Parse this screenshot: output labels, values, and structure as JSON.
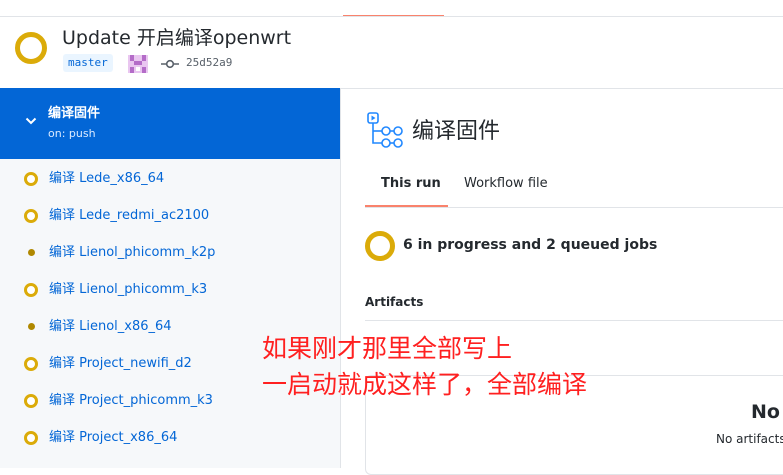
{
  "header": {
    "title": "Update 开启编译openwrt",
    "branch": "master",
    "commit_sha": "25d52a9"
  },
  "sidebar": {
    "workflow": {
      "name": "编译固件",
      "trigger": "on: push"
    },
    "jobs": [
      {
        "label": "编译 Lede_x86_64",
        "status": "in_progress"
      },
      {
        "label": "编译 Lede_redmi_ac2100",
        "status": "in_progress"
      },
      {
        "label": "编译 Lienol_phicomm_k2p",
        "status": "queued"
      },
      {
        "label": "编译 Lienol_phicomm_k3",
        "status": "in_progress"
      },
      {
        "label": "编译 Lienol_x86_64",
        "status": "queued"
      },
      {
        "label": "编译 Project_newifi_d2",
        "status": "in_progress"
      },
      {
        "label": "编译 Project_phicomm_k3",
        "status": "in_progress"
      },
      {
        "label": "编译 Project_x86_64",
        "status": "in_progress"
      }
    ]
  },
  "main": {
    "title": "编译固件",
    "tabs": [
      {
        "label": "This run",
        "active": true
      },
      {
        "label": "Workflow file",
        "active": false
      }
    ],
    "summary": "6 in progress and 2 queued jobs",
    "artifacts": {
      "title": "Artifacts",
      "empty_title": "No",
      "empty_sub": "No artifacts"
    }
  },
  "annotation": {
    "line1": "如果刚才那里全部写上",
    "line2": "一启动就成这样了，全部编译"
  },
  "colors": {
    "accent": "#0366d6",
    "in_progress": "#dbab09",
    "queued": "#b08800",
    "tab_underline": "#f9826c",
    "annotation": "#ff2020"
  },
  "icons": [
    "status-in-progress-icon",
    "avatar",
    "git-commit-icon",
    "chevron-down-icon",
    "workflow-icon",
    "queued-dot-icon"
  ]
}
